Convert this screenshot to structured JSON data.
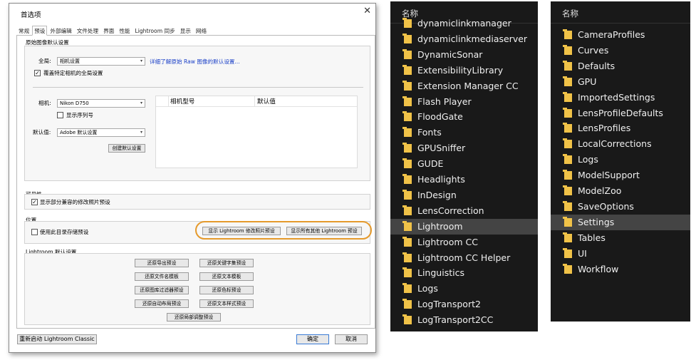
{
  "dialog": {
    "title": "首选项",
    "tabs": [
      "常规",
      "预设",
      "外部编辑",
      "文件处理",
      "界面",
      "性能",
      "Lightroom 同步",
      "显示",
      "网络"
    ],
    "raw_section": {
      "title": "原始图像默认设置",
      "global_label": "全局:",
      "global_value": "相机设置",
      "raw_link": "详细了解原始 Raw 图像的默认设置...",
      "override_check": "覆盖特定相机的全局设置",
      "camera_label": "相机:",
      "camera_value": "Nikon D750",
      "serial_check": "显示序列号",
      "default_label": "默认值:",
      "default_value": "Adobe 默认设置",
      "create_btn": "创建默认设置",
      "table_headers": [
        "相机型号",
        "默认值"
      ]
    },
    "visibility": {
      "title": "可见性",
      "check": "显示部分兼容的修改照片预设"
    },
    "location": {
      "title": "位置",
      "check": "使用此目录存储预设",
      "btn1": "显示 Lightroom 修改照片预设",
      "btn2": "显示所有其他 Lightroom 预设"
    },
    "lr_defaults": {
      "title": "Lightroom 默认设置",
      "buttons": [
        "还原导出预设",
        "还原关键字集预设",
        "还原文件名模板",
        "还原文本模板",
        "还原图库过滤器预设",
        "还原色标预设",
        "还原自动布局预设",
        "还原文本样式预设",
        "还原局部调整预设"
      ]
    },
    "restart_btn": "重新启动 Lightroom Classic",
    "ok_btn": "确定",
    "cancel_btn": "取消"
  },
  "explorer1": {
    "header": "名称",
    "items": [
      "dynamiclinkmanager",
      "dynamiclinkmediaserver",
      "DynamicSonar",
      "ExtensibilityLibrary",
      "Extension Manager CC",
      "Flash Player",
      "FloodGate",
      "Fonts",
      "GPUSniffer",
      "GUDE",
      "Headlights",
      "InDesign",
      "LensCorrection",
      "Lightroom",
      "Lightroom CC",
      "Lightroom CC Helper",
      "Linguistics",
      "Logs",
      "LogTransport2",
      "LogTransport2CC"
    ],
    "selected": "Lightroom"
  },
  "explorer2": {
    "header": "名称",
    "items": [
      "CameraProfiles",
      "Curves",
      "Defaults",
      "GPU",
      "ImportedSettings",
      "LensProfileDefaults",
      "LensProfiles",
      "LocalCorrections",
      "Logs",
      "ModelSupport",
      "ModelZoo",
      "SaveOptions",
      "Settings",
      "Tables",
      "UI",
      "Workflow"
    ],
    "selected": "Settings"
  },
  "colors": {
    "folder": "#f0c248",
    "highlight_ring": "#e59a2c",
    "explorer_bg": "#191919",
    "link": "#1a3fc7"
  }
}
